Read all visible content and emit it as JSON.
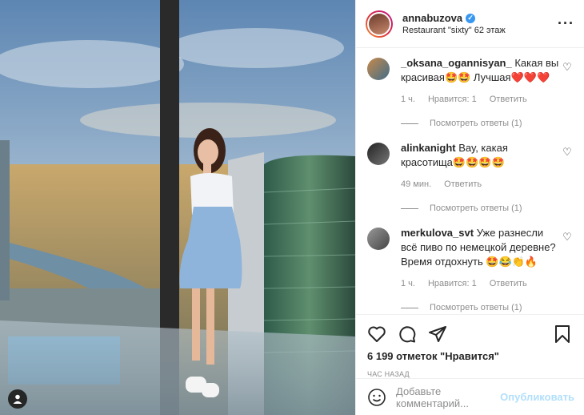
{
  "post": {
    "username": "annabuzova",
    "location": "Restaurant \"sixty\" 62 этаж"
  },
  "comments": [
    {
      "user": "_oksana_ogannisyan_",
      "text": "Какая вы красивая🤩🤩 Лучшая❤️❤️❤️",
      "time": "1 ч.",
      "likes": "Нравится: 1",
      "reply": "Ответить",
      "replies": "Посмотреть ответы (1)"
    },
    {
      "user": "alinkanight",
      "text": "Вау, какая красотища🤩🤩🤩🤩",
      "time": "49 мин.",
      "reply": "Ответить",
      "replies": "Посмотреть ответы (1)"
    },
    {
      "user": "merkulova_svt",
      "text": "Уже разнесли всё пиво по немецкой деревне? Время отдохнуть 🤩😂👏🔥",
      "time": "1 ч.",
      "likes": "Нравится: 1",
      "reply": "Ответить",
      "replies": "Посмотреть ответы (1)"
    }
  ],
  "actions": {
    "likes_text": "6 199 отметок \"Нравится\"",
    "posted": "ЧАС НАЗАД"
  },
  "add_comment": {
    "placeholder": "Добавьте комментарий...",
    "publish": "Опубликовать"
  },
  "icons": {
    "more": "more-options-icon",
    "heart": "heart-icon",
    "comment": "comment-icon",
    "share": "share-icon",
    "save": "bookmark-icon",
    "emoji": "emoji-icon",
    "tag": "user-tag-icon"
  },
  "colors": {
    "text": "#262626",
    "muted": "#8e8e8e",
    "verified": "#3897f0",
    "publish_disabled": "#b2dffc"
  }
}
